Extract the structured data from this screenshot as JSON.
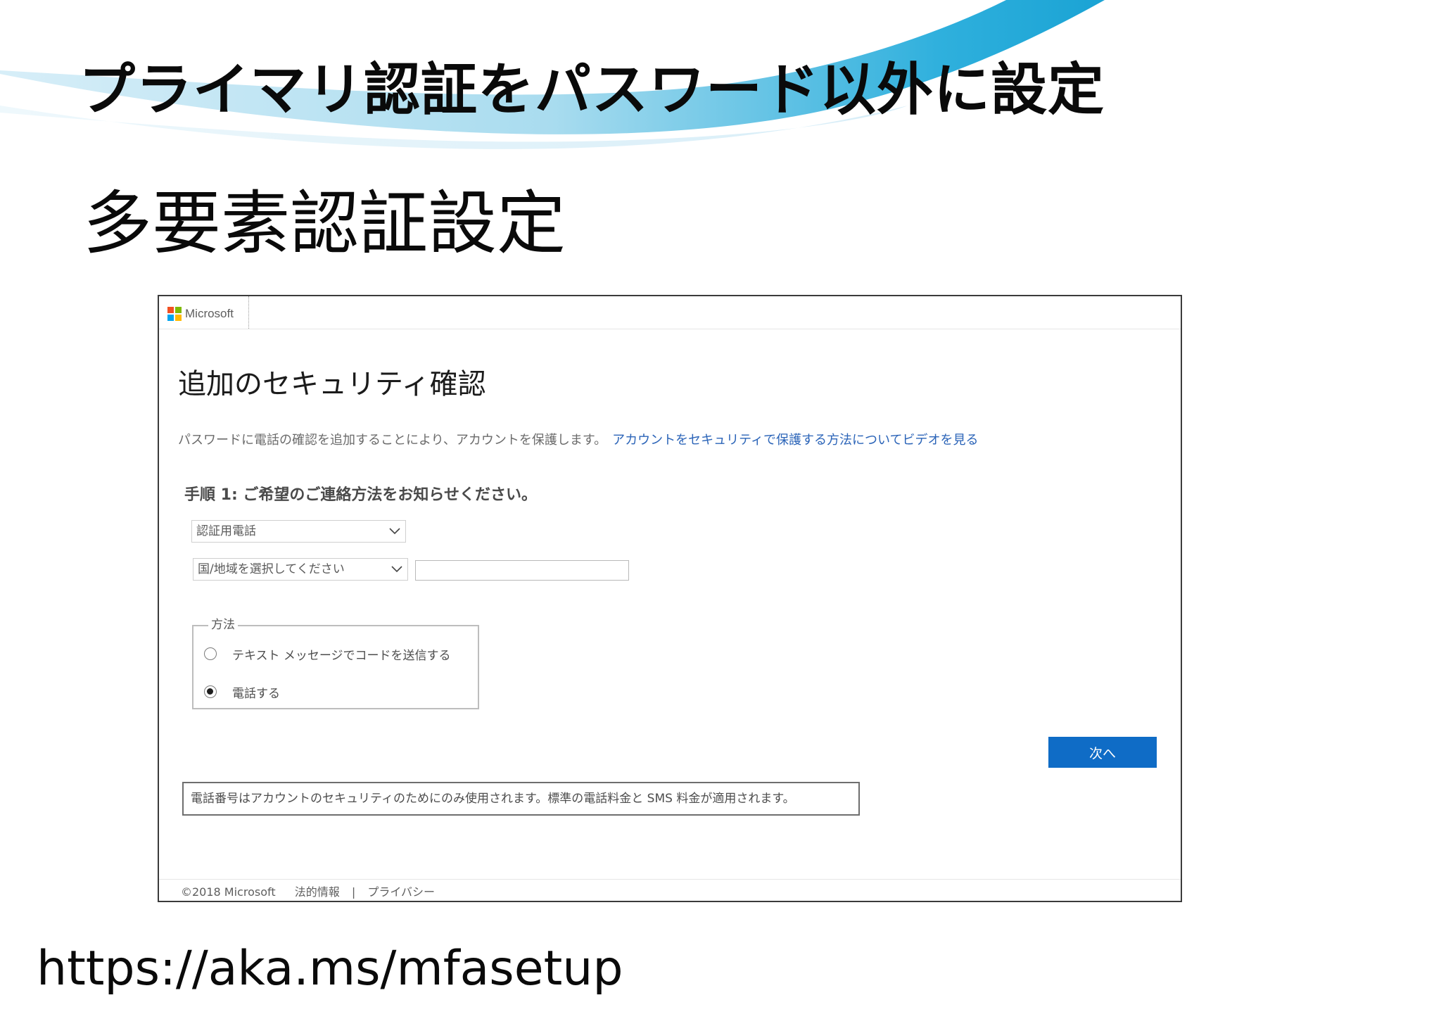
{
  "slide": {
    "title": "プライマリ認証をパスワード以外に設定",
    "subtitle": "多要素認証設定",
    "url": "https://aka.ms/mfasetup"
  },
  "window": {
    "brand": "Microsoft",
    "heading": "追加のセキュリティ確認",
    "intro_text": "パスワードに電話の確認を追加することにより、アカウントを保護します。",
    "intro_link": "アカウントをセキュリティで保護する方法についてビデオを見る",
    "step_heading": "手順 1: ご希望のご連絡方法をお知らせください。",
    "contact_type_select": {
      "selected": "認証用電話"
    },
    "country_select": {
      "selected": "国/地域を選択してください"
    },
    "phone_input": {
      "value": ""
    },
    "method": {
      "legend": "方法",
      "options": [
        {
          "label": "テキスト メッセージでコードを送信する",
          "checked": false
        },
        {
          "label": "電話する",
          "checked": true
        }
      ]
    },
    "next_button": "次へ",
    "notice": "電話番号はアカウントのセキュリティのためにのみ使用されます。標準の電話料金と SMS 料金が適用されます。",
    "footer": {
      "copyright": "©2018 Microsoft",
      "legal": "法的情報",
      "separator": "|",
      "privacy": "プライバシー"
    }
  },
  "colors": {
    "button_blue": "#0f6cc6",
    "link_blue": "#2b64b8",
    "swoosh_dark": "#1aa3d4",
    "swoosh_light": "#cde9f6"
  }
}
